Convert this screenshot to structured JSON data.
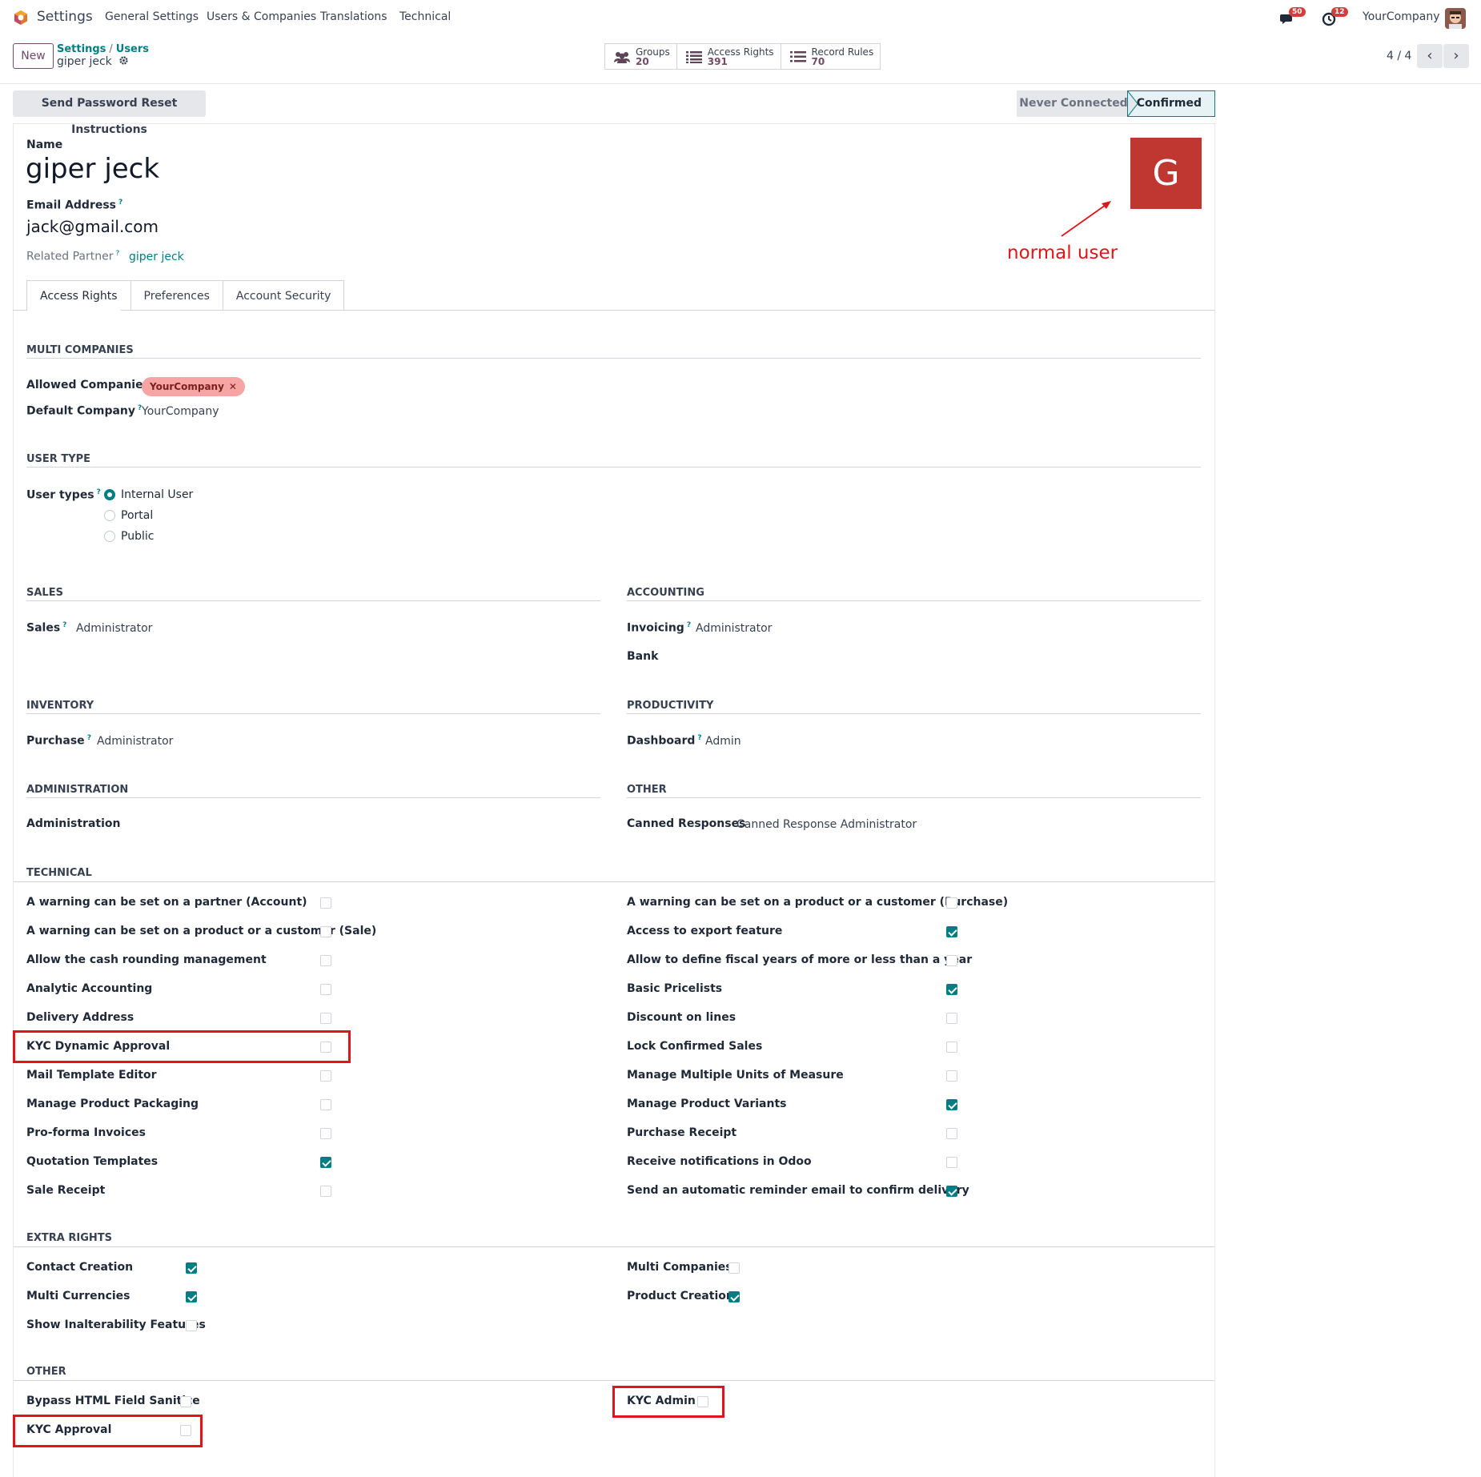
{
  "navbar": {
    "app_title": "Settings",
    "menu": [
      "General Settings",
      "Users & Companies",
      "Translations",
      "Technical"
    ],
    "messages_count": "50",
    "activities_count": "12",
    "company": "YourCompany"
  },
  "control_panel": {
    "new_label": "New",
    "breadcrumb": [
      "Settings",
      "Users"
    ],
    "current_record": "giper jeck",
    "smart_buttons": [
      {
        "label": "Groups",
        "value": "20",
        "icon": "users-icon"
      },
      {
        "label": "Access Rights",
        "value": "391",
        "icon": "list-icon"
      },
      {
        "label": "Record Rules",
        "value": "70",
        "icon": "list-icon"
      }
    ],
    "pager": "4 / 4"
  },
  "statusbar": {
    "reset_button": "Send Password Reset Instructions",
    "stages": [
      "Never Connected",
      "Confirmed"
    ],
    "current_stage": "Confirmed"
  },
  "form": {
    "name_label": "Name",
    "name": "giper jeck",
    "email_label": "Email Address",
    "email": "jack@gmail.com",
    "partner_label": "Related Partner",
    "partner": "giper jeck",
    "avatar_letter": "G",
    "avatar_color": "#c03630",
    "annotation": "normal user"
  },
  "tabs": [
    "Access Rights",
    "Preferences",
    "Account Security"
  ],
  "multi_companies": {
    "title": "MULTI COMPANIES",
    "allowed_label": "Allowed Companies",
    "allowed": "YourCompany",
    "default_label": "Default Company",
    "default": "YourCompany"
  },
  "user_type": {
    "title": "USER TYPE",
    "label": "User types",
    "options": [
      "Internal User",
      "Portal",
      "Public"
    ],
    "selected": "Internal User"
  },
  "apps": {
    "sales": {
      "title": "SALES",
      "label": "Sales",
      "value": "Administrator"
    },
    "accounting": {
      "title": "ACCOUNTING",
      "invoicing_label": "Invoicing",
      "invoicing_value": "Administrator",
      "bank_label": "Bank"
    },
    "inventory": {
      "title": "INVENTORY",
      "label": "Purchase",
      "value": "Administrator"
    },
    "productivity": {
      "title": "PRODUCTIVITY",
      "label": "Dashboard",
      "value": "Admin"
    },
    "administration": {
      "title": "ADMINISTRATION",
      "label": "Administration"
    },
    "other": {
      "title": "OTHER",
      "label": "Canned Responses",
      "value": "Canned Response Administrator"
    }
  },
  "technical": {
    "title": "TECHNICAL",
    "left": [
      {
        "label": "A warning can be set on a partner (Account)",
        "checked": false
      },
      {
        "label": "A warning can be set on a product or a customer (Sale)",
        "checked": false
      },
      {
        "label": "Allow the cash rounding management",
        "checked": false
      },
      {
        "label": "Analytic Accounting",
        "checked": false
      },
      {
        "label": "Delivery Address",
        "checked": false
      },
      {
        "label": "KYC Dynamic Approval",
        "checked": false
      },
      {
        "label": "Mail Template Editor",
        "checked": false
      },
      {
        "label": "Manage Product Packaging",
        "checked": false
      },
      {
        "label": "Pro-forma Invoices",
        "checked": false
      },
      {
        "label": "Quotation Templates",
        "checked": true
      },
      {
        "label": "Sale Receipt",
        "checked": false
      }
    ],
    "right": [
      {
        "label": "A warning can be set on a product or a customer (Purchase)",
        "checked": false
      },
      {
        "label": "Access to export feature",
        "checked": true
      },
      {
        "label": "Allow to define fiscal years of more or less than a year",
        "checked": false
      },
      {
        "label": "Basic Pricelists",
        "checked": true
      },
      {
        "label": "Discount on lines",
        "checked": false
      },
      {
        "label": "Lock Confirmed Sales",
        "checked": false
      },
      {
        "label": "Manage Multiple Units of Measure",
        "checked": false
      },
      {
        "label": "Manage Product Variants",
        "checked": true
      },
      {
        "label": "Purchase Receipt",
        "checked": false
      },
      {
        "label": "Receive notifications in Odoo",
        "checked": false
      },
      {
        "label": "Send an automatic reminder email to confirm delivery",
        "checked": true
      }
    ]
  },
  "extra_rights": {
    "title": "EXTRA RIGHTS",
    "left": [
      {
        "label": "Contact Creation",
        "checked": true
      },
      {
        "label": "Multi Currencies",
        "checked": true
      },
      {
        "label": "Show Inalterability Features",
        "checked": false
      }
    ],
    "right": [
      {
        "label": "Multi Companies",
        "checked": false
      },
      {
        "label": "Product Creation",
        "checked": true
      }
    ]
  },
  "other_section": {
    "title": "OTHER",
    "left": [
      {
        "label": "Bypass HTML Field Sanitize",
        "checked": false
      },
      {
        "label": "KYC Approval",
        "checked": false
      }
    ],
    "right": [
      {
        "label": "KYC Admin",
        "checked": false
      }
    ]
  },
  "colors": {
    "brand": "#714b67",
    "accent": "#017e84",
    "annotation": "#e0141b"
  }
}
